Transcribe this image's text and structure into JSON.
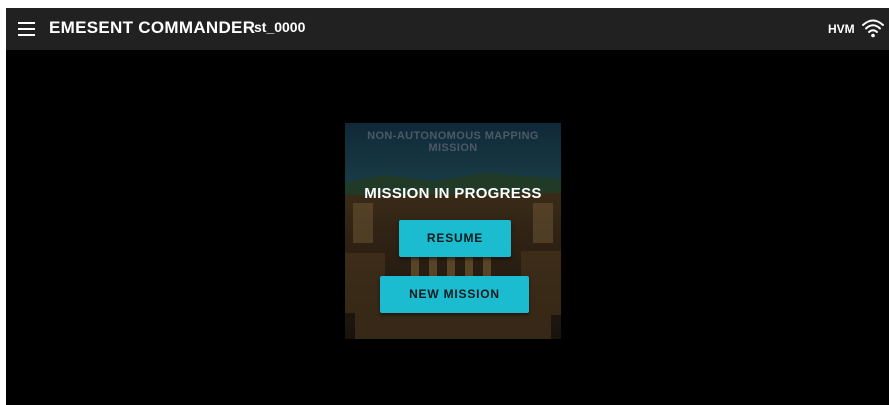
{
  "header": {
    "menu_icon": "hamburger-menu-icon",
    "app_title": "EMESENT COMMANDER",
    "station_id": "st_0000",
    "vehicle_label": "HVM",
    "wifi_icon": "wifi-signal-icon"
  },
  "mission_card": {
    "mission_type": "NON-AUTONOMOUS MAPPING MISSION",
    "status": "MISSION IN PROGRESS",
    "resume_label": "RESUME",
    "new_mission_label": "NEW MISSION"
  },
  "colors": {
    "topbar_bg": "#212121",
    "screen_bg": "#000000",
    "button_accent": "#1bbccf",
    "mission_type_text": "#4a5a66"
  }
}
